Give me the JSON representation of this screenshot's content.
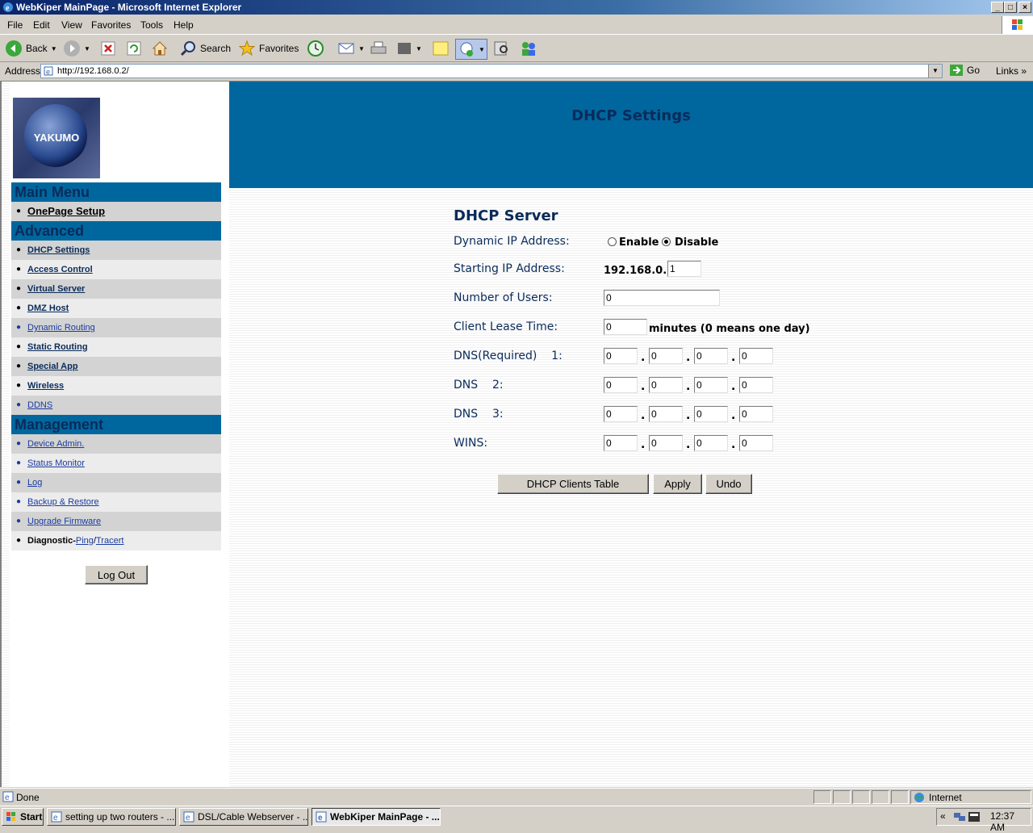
{
  "window": {
    "title": "WebKiper MainPage - Microsoft Internet Explorer",
    "controls": {
      "minimize": "_",
      "maximize": "□",
      "close": "×"
    }
  },
  "menubar": [
    "File",
    "Edit",
    "View",
    "Favorites",
    "Tools",
    "Help"
  ],
  "toolbar": {
    "back": "Back",
    "search": "Search",
    "favorites": "Favorites"
  },
  "address": {
    "label": "Address",
    "url": "http://192.168.0.2/",
    "go": "Go",
    "links": "Links",
    "more": "»"
  },
  "sidebar": {
    "logo_text": "YAKUMO",
    "main_menu_header": "Main Menu",
    "main_items": [
      {
        "label": "OnePage Setup"
      }
    ],
    "advanced_header": "Advanced",
    "advanced_items": [
      {
        "label": "DHCP Settings"
      },
      {
        "label": "Access Control"
      },
      {
        "label": "Virtual Server"
      },
      {
        "label": "DMZ Host"
      },
      {
        "label": "Dynamic Routing"
      },
      {
        "label": "Static Routing"
      },
      {
        "label": "Special App"
      },
      {
        "label": "Wireless"
      },
      {
        "label": "DDNS"
      }
    ],
    "management_header": "Management",
    "management_items": [
      {
        "label": "Device Admin."
      },
      {
        "label": "Status Monitor"
      },
      {
        "label": "Log"
      },
      {
        "label": "Backup & Restore"
      },
      {
        "label": "Upgrade Firmware"
      }
    ],
    "diagnostic": {
      "prefix": "Diagnostic-",
      "ping": "Ping",
      "slash": "/",
      "tracert": "Tracert"
    },
    "logout": "Log Out",
    "bullet": "●"
  },
  "page": {
    "banner_title": "DHCP Settings",
    "section_title": "DHCP Server",
    "dynamic_ip": {
      "label": "Dynamic IP Address:",
      "enable": "Enable",
      "disable": "Disable",
      "selected": "Disable"
    },
    "starting_ip": {
      "label": "Starting IP Address:",
      "prefix": "192.168.0.",
      "value": "1"
    },
    "num_users": {
      "label": "Number of Users:",
      "value": "0"
    },
    "lease": {
      "label": "Client Lease Time:",
      "value": "0",
      "suffix": "minutes (0 means one day)"
    },
    "dns1": {
      "label": "DNS(Required)    1:",
      "octets": [
        "0",
        "0",
        "0",
        "0"
      ]
    },
    "dns2": {
      "label": "DNS    2:",
      "octets": [
        "0",
        "0",
        "0",
        "0"
      ]
    },
    "dns3": {
      "label": "DNS    3:",
      "octets": [
        "0",
        "0",
        "0",
        "0"
      ]
    },
    "wins": {
      "label": "WINS:",
      "octets": [
        "0",
        "0",
        "0",
        "0"
      ]
    },
    "dot": ".",
    "buttons": {
      "clients_table": "DHCP Clients Table",
      "apply": "Apply",
      "undo": "Undo"
    }
  },
  "statusbar": {
    "text": "Done",
    "zone": "Internet"
  },
  "taskbar": {
    "start": "Start",
    "tasks": [
      {
        "label": "setting up two routers - ..."
      },
      {
        "label": "DSL/Cable Webserver - ..."
      },
      {
        "label": "WebKiper MainPage - ..."
      }
    ],
    "tray_arrow": "«",
    "clock": "12:37 AM"
  }
}
